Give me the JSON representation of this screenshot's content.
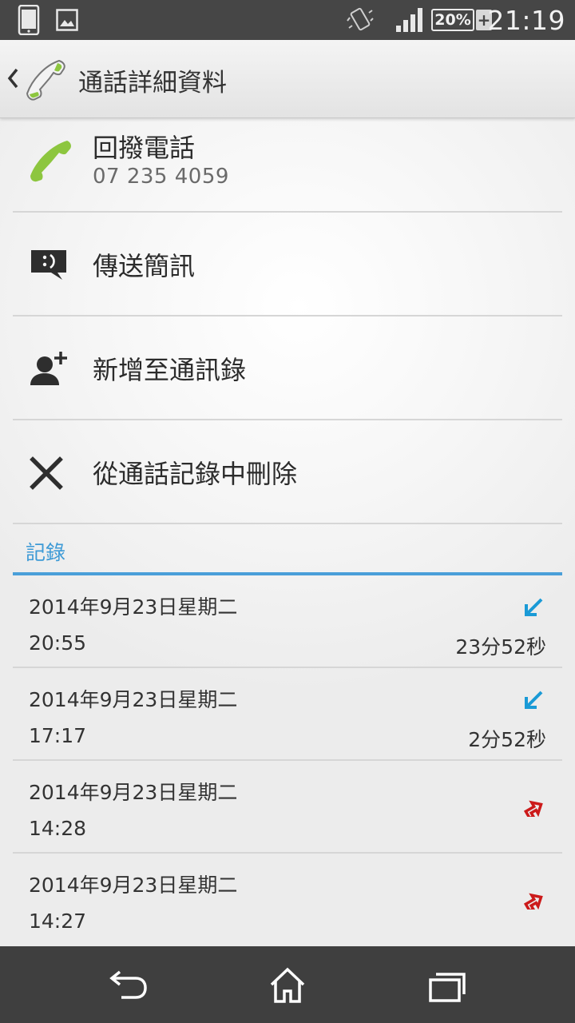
{
  "status_bar": {
    "time": "21:19",
    "battery_percent": "20%",
    "battery_charging_symbol": "+",
    "icons": [
      "phone-icon",
      "image-icon",
      "vibrate-icon",
      "signal-icon",
      "battery-icon"
    ]
  },
  "action_bar": {
    "title": "通話詳細資料",
    "icon": "phone-handset-icon"
  },
  "actions": [
    {
      "label": "回撥電話",
      "sub": "07 235 4059",
      "icon": "call-back-icon"
    },
    {
      "label": "傳送簡訊",
      "icon": "message-icon"
    },
    {
      "label": "新增至通訊錄",
      "icon": "add-contact-icon"
    },
    {
      "label": "從通話記錄中刪除",
      "icon": "delete-x-icon"
    }
  ],
  "log_section": {
    "header": "記錄",
    "entries": [
      {
        "date": "2014年9月23日星期二",
        "time": "20:55",
        "duration": "23分52秒",
        "type": "incoming"
      },
      {
        "date": "2014年9月23日星期二",
        "time": "17:17",
        "duration": "2分52秒",
        "type": "incoming"
      },
      {
        "date": "2014年9月23日星期二",
        "time": "14:28",
        "duration": "",
        "type": "outgoing"
      },
      {
        "date": "2014年9月23日星期二",
        "time": "14:27",
        "duration": "",
        "type": "outgoing"
      }
    ]
  },
  "colors": {
    "accent": "#4a9fd9",
    "incoming": "#1a9ad6",
    "outgoing": "#cc1a1a",
    "call_green": "#8dc63f"
  },
  "nav_bar": {
    "icons": [
      "back-icon",
      "home-icon",
      "recent-apps-icon"
    ]
  }
}
